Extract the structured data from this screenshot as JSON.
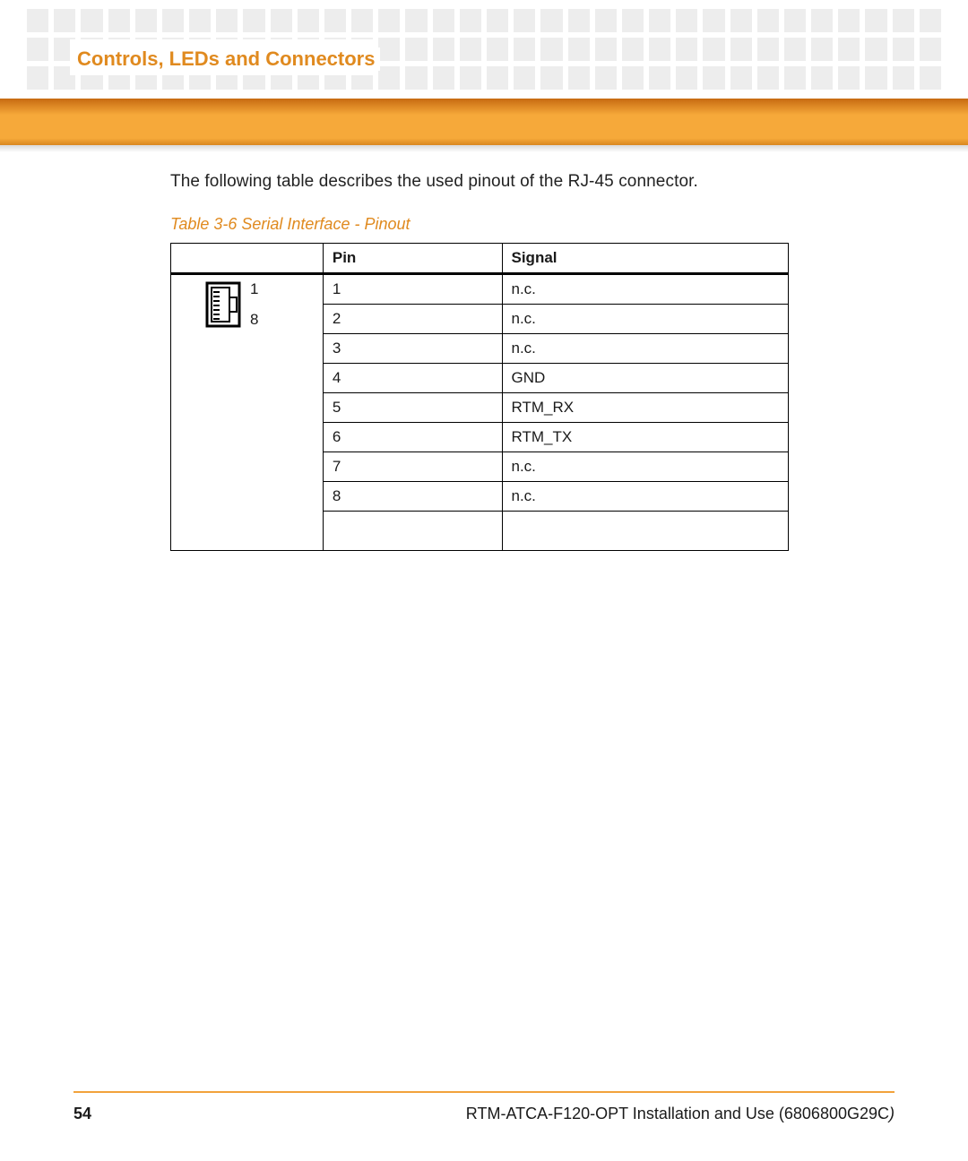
{
  "header": {
    "section_title": "Controls, LEDs and Connectors"
  },
  "content": {
    "intro": "The following table describes the used pinout of the RJ-45 connector.",
    "table_caption": "Table 3-6 Serial Interface - Pinout",
    "columns": {
      "pin": "Pin",
      "signal": "Signal"
    },
    "connector_labels": {
      "top": "1",
      "bottom": "8"
    },
    "rows": [
      {
        "pin": "1",
        "signal": "n.c."
      },
      {
        "pin": "2",
        "signal": "n.c."
      },
      {
        "pin": "3",
        "signal": "n.c."
      },
      {
        "pin": "4",
        "signal": "GND"
      },
      {
        "pin": "5",
        "signal": "RTM_RX"
      },
      {
        "pin": "6",
        "signal": "RTM_TX"
      },
      {
        "pin": "7",
        "signal": "n.c."
      },
      {
        "pin": "8",
        "signal": "n.c."
      }
    ]
  },
  "footer": {
    "page_number": "54",
    "doc_title": "RTM-ATCA-F120-OPT Installation and Use (6806800G29C",
    "doc_id_suffix": ")"
  }
}
